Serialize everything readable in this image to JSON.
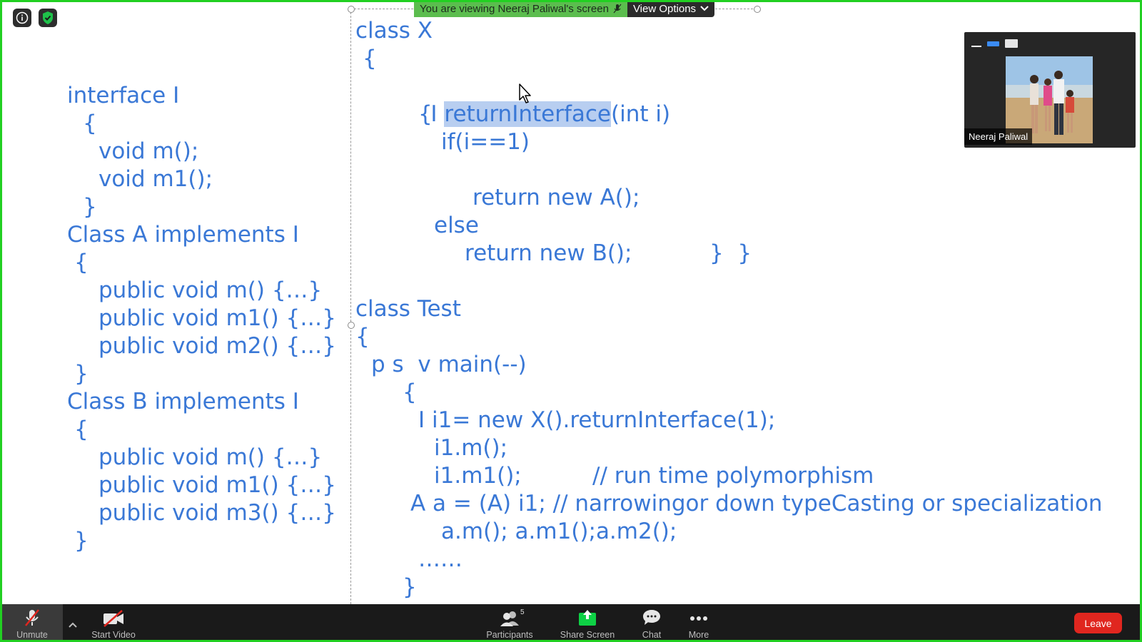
{
  "banner": {
    "viewing_text": "You are viewing Neeraj Paliwal's screen",
    "view_options": "View Options"
  },
  "shared_screen": {
    "left_code": [
      "interface I",
      "{",
      "void m();",
      "void m1();",
      "}",
      "Class A implements I",
      "{",
      "public void m() {…}",
      "public void m1() {…}",
      "public void m2() {…}",
      "}",
      "Class B implements I",
      "{",
      "public void m() {…}",
      "public void m1() {…}",
      "public void m3() {…}",
      "}"
    ],
    "right_code": {
      "l1": "class X",
      "l2": "{",
      "l3_pre": "I ",
      "l3_hl": "returnInterface",
      "l3_post": "(int i)",
      "l4": "{",
      "l5": "if(i==1)",
      "l6": "return new A();",
      "l7": "else",
      "l8": "return new B();",
      "l8b": "}  }",
      "l9": "class Test",
      "l10": "{",
      "l11": "p s  v main(--)",
      "l12": "{",
      "l13": "I i1= new X().returnInterface(1);",
      "l14": "i1.m();",
      "l15": "i1.m1();",
      "l15b": "// run time polymorphism",
      "l16": "A a = (A) i1; // narrowingor down typeCasting or specialization",
      "l17": "a.m(); a.m1();a.m2();",
      "l18": "……",
      "l19": "}"
    }
  },
  "thumbnail": {
    "participant_name": "Neeraj Paliwal"
  },
  "toolbar": {
    "unmute": "Unmute",
    "start_video": "Start Video",
    "participants": "Participants",
    "participants_count": "5",
    "share_screen": "Share Screen",
    "chat": "Chat",
    "more": "More",
    "leave": "Leave"
  },
  "colors": {
    "frame_border": "#22d022",
    "code_text": "#3a78d6",
    "code_highlight": "#b8cef0",
    "banner_green": "#5bbd4e",
    "share_green": "#0ed145",
    "leave_red": "#e0261f",
    "toolbar_bg": "#1a1a1a"
  }
}
